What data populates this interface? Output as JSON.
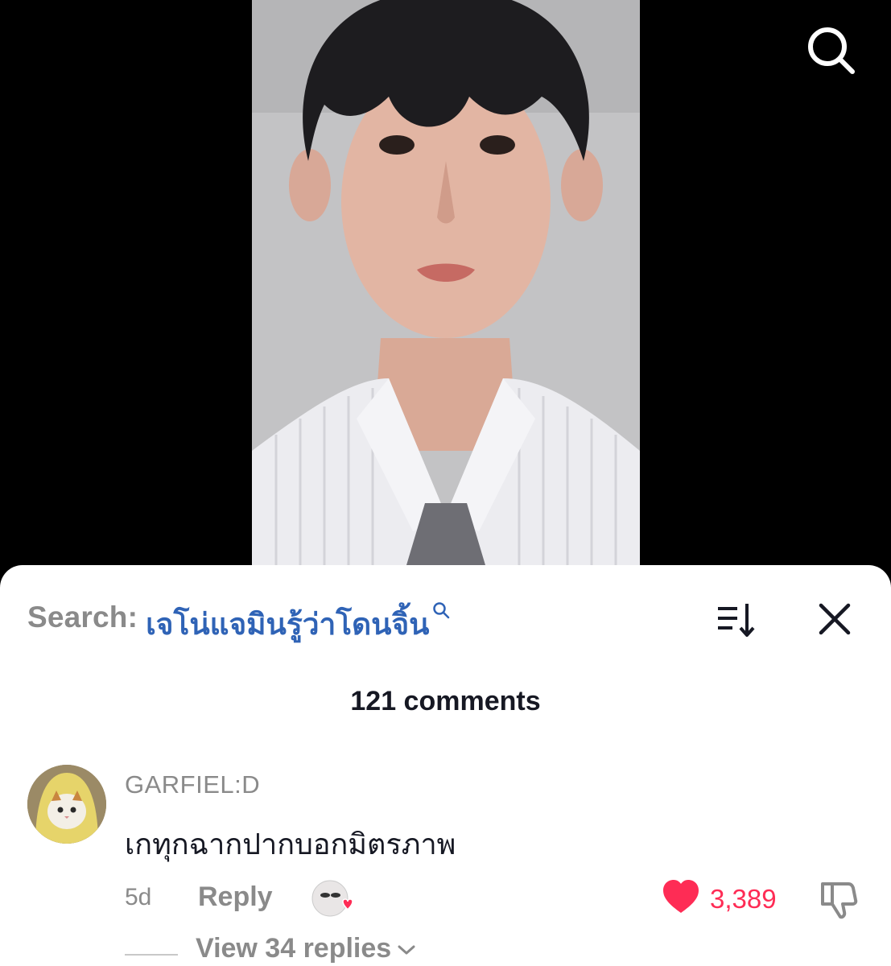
{
  "header": {
    "search_icon": "search-icon"
  },
  "comments_panel": {
    "search_prefix": "Search:",
    "search_query": "เจโน่แจมินรู้ว่าโดนจิ้น",
    "count_label": "121 comments",
    "sort_icon": "sort-icon",
    "close_icon": "close-icon"
  },
  "comment": {
    "username": "GARFIEL:D",
    "text": "เกทุกฉากปากบอกมิตรภาพ",
    "time": "5d",
    "reply_label": "Reply",
    "like_count": "3,389",
    "view_replies_label": "View 34 replies"
  },
  "colors": {
    "accent_blue": "#2f63b6",
    "like_red": "#fe2c55",
    "muted_gray": "#8a8a8a"
  }
}
